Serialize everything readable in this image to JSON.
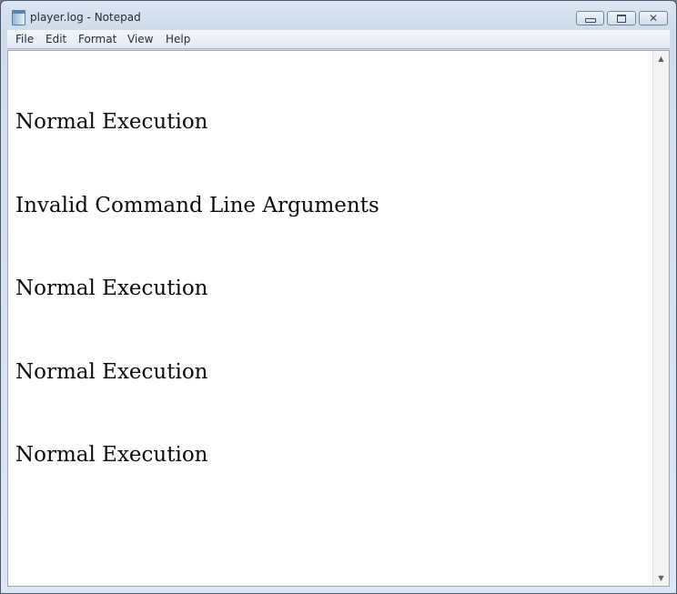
{
  "window": {
    "title": "player.log - Notepad",
    "icon": "notepad-icon",
    "controls": {
      "minimize": "minimize-icon",
      "maximize": "maximize-icon",
      "close": "close-icon"
    }
  },
  "menu": {
    "items": [
      {
        "label": "File"
      },
      {
        "label": "Edit"
      },
      {
        "label": "Format"
      },
      {
        "label": "View"
      },
      {
        "label": "Help"
      }
    ]
  },
  "editor": {
    "lines": [
      "Normal Execution",
      "Invalid Command Line Arguments",
      "Normal Execution",
      "Normal Execution",
      "Normal Execution"
    ]
  },
  "scrollbar": {
    "up_arrow": "▲",
    "down_arrow": "▼"
  }
}
